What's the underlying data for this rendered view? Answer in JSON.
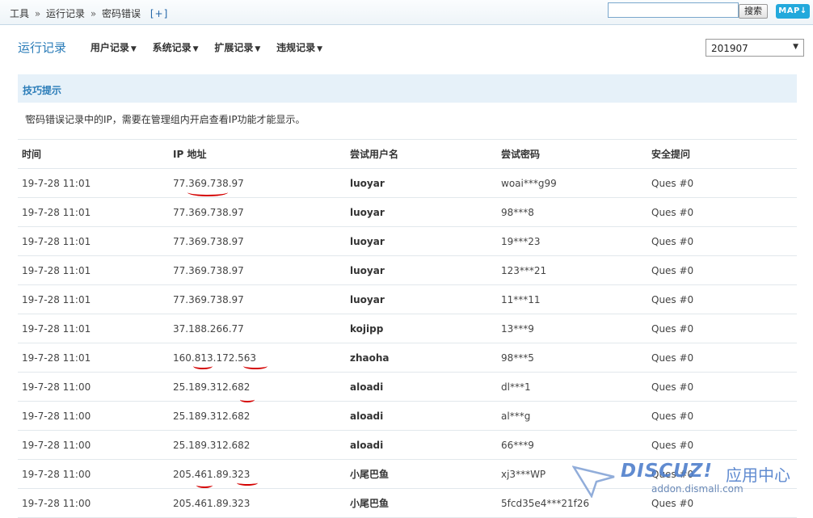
{
  "breadcrumb": {
    "items": [
      "工具",
      "运行记录",
      "密码错误"
    ],
    "separator": "»",
    "add_label": "[+]"
  },
  "search": {
    "value": "",
    "button_label": "搜索"
  },
  "map_button": {
    "label": "MAP"
  },
  "nav": {
    "current": "运行记录",
    "menus": [
      "用户记录",
      "系统记录",
      "扩展记录",
      "违规记录"
    ]
  },
  "month_select": {
    "value": "201907"
  },
  "tips": {
    "title": "技巧提示",
    "text": "密码错误记录中的IP，需要在管理组内开启查看IP功能才能显示。"
  },
  "table": {
    "headers": [
      "时间",
      "IP 地址",
      "尝试用户名",
      "尝试密码",
      "安全提问"
    ],
    "rows": [
      [
        "19-7-28 11:01",
        "77.369.738.97",
        "luoyar",
        "woai***g99",
        "Ques #0"
      ],
      [
        "19-7-28 11:01",
        "77.369.738.97",
        "luoyar",
        "98***8",
        "Ques #0"
      ],
      [
        "19-7-28 11:01",
        "77.369.738.97",
        "luoyar",
        "19***23",
        "Ques #0"
      ],
      [
        "19-7-28 11:01",
        "77.369.738.97",
        "luoyar",
        "123***21",
        "Ques #0"
      ],
      [
        "19-7-28 11:01",
        "77.369.738.97",
        "luoyar",
        "11***11",
        "Ques #0"
      ],
      [
        "19-7-28 11:01",
        "37.188.266.77",
        "kojipp",
        "13***9",
        "Ques #0"
      ],
      [
        "19-7-28 11:01",
        "160.813.172.563",
        "zhaoha",
        "98***5",
        "Ques #0"
      ],
      [
        "19-7-28 11:00",
        "25.189.312.682",
        "aloadi",
        "dl***1",
        "Ques #0"
      ],
      [
        "19-7-28 11:00",
        "25.189.312.682",
        "aloadi",
        "al***g",
        "Ques #0"
      ],
      [
        "19-7-28 11:00",
        "25.189.312.682",
        "aloadi",
        "66***9",
        "Ques #0"
      ],
      [
        "19-7-28 11:00",
        "205.461.89.323",
        "小尾巴鱼",
        "xj3***WP",
        "Ques #0"
      ],
      [
        "19-7-28 11:00",
        "205.461.89.323",
        "小尾巴鱼",
        "5fcd35e4***21f26",
        "Ques #0"
      ]
    ]
  },
  "watermark": {
    "brand": "DISCUZ!",
    "cn": "应用中心",
    "domain": "addon.dismall.com"
  },
  "colors": {
    "accent": "#2a7cb8",
    "tips_bg": "#e6f1f9",
    "annotation": "#d40000"
  }
}
